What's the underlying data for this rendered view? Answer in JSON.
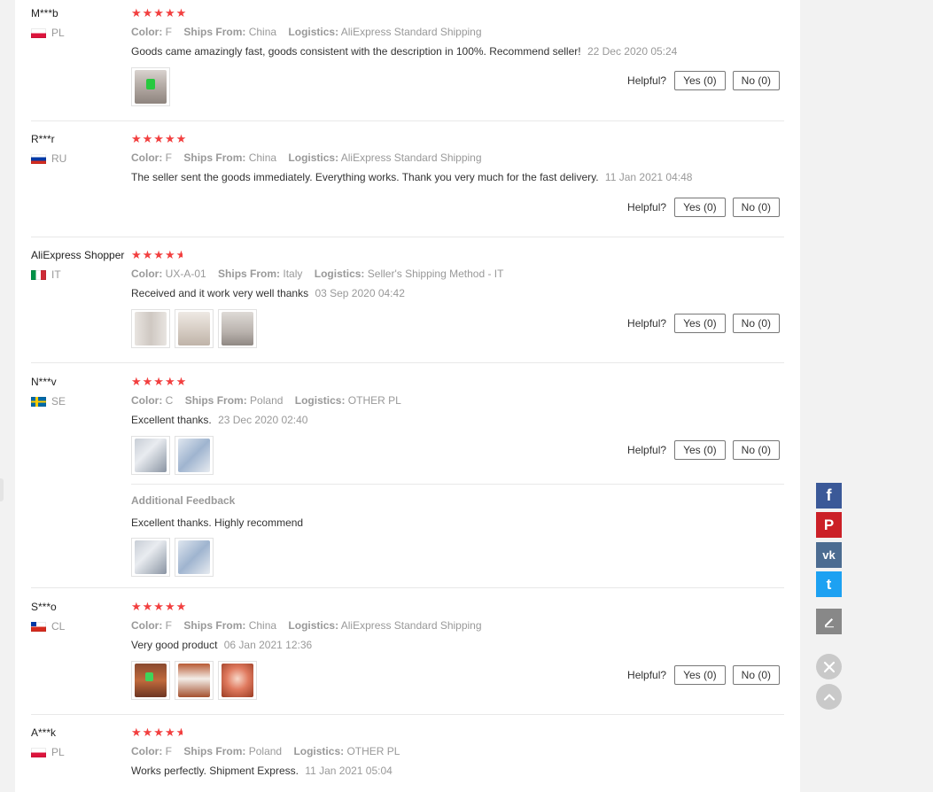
{
  "labels": {
    "color": "Color:",
    "ships_from": "Ships From:",
    "logistics": "Logistics:",
    "helpful": "Helpful?",
    "additional_feedback": "Additional Feedback"
  },
  "reviews": [
    {
      "name": "M***b",
      "country": "PL",
      "stars": 5,
      "color": "F",
      "ships_from": "China",
      "logistics": "AliExpress Standard Shipping",
      "text": "Goods came amazingly fast, goods consistent with the description in 100%. Recommend seller!",
      "date": "22 Dec 2020 05:24",
      "yes": "Yes (0)",
      "no": "No (0)"
    },
    {
      "name": "R***r",
      "country": "RU",
      "stars": 5,
      "color": "F",
      "ships_from": "China",
      "logistics": "AliExpress Standard Shipping",
      "text": "The seller sent the goods immediately. Everything works. Thank you very much for the fast delivery.",
      "date": "11 Jan 2021 04:48",
      "yes": "Yes (0)",
      "no": "No (0)"
    },
    {
      "name": "AliExpress Shopper",
      "country": "IT",
      "stars": 4.5,
      "color": "UX-A-01",
      "ships_from": "Italy",
      "logistics": "Seller's Shipping Method - IT",
      "text": "Received and it work very well thanks",
      "date": "03 Sep 2020 04:42",
      "yes": "Yes (0)",
      "no": "No (0)"
    },
    {
      "name": "N***v",
      "country": "SE",
      "stars": 5,
      "color": "C",
      "ships_from": "Poland",
      "logistics": "OTHER PL",
      "text": "Excellent thanks.",
      "date": "23 Dec 2020 02:40",
      "yes": "Yes (0)",
      "no": "No (0)",
      "additional_text": "Excellent thanks. Highly recommend"
    },
    {
      "name": "S***o",
      "country": "CL",
      "stars": 5,
      "color": "F",
      "ships_from": "China",
      "logistics": "AliExpress Standard Shipping",
      "text": "Very good product",
      "date": "06 Jan 2021 12:36",
      "yes": "Yes (0)",
      "no": "No (0)"
    },
    {
      "name": "A***k",
      "country": "PL",
      "stars": 4.5,
      "color": "F",
      "ships_from": "Poland",
      "logistics": "OTHER PL",
      "text": "Works perfectly. Shipment Express.",
      "date": "11 Jan 2021 05:04"
    }
  ],
  "share": {
    "facebook_icon": "f",
    "pinterest_icon": "P",
    "vk_icon": "vk",
    "twitter_icon": "t"
  },
  "colors": {
    "star": "#f23f3f",
    "facebook": "#3b5998",
    "pinterest": "#cb2027",
    "vk": "#4c6c91",
    "twitter": "#1da1f2"
  }
}
